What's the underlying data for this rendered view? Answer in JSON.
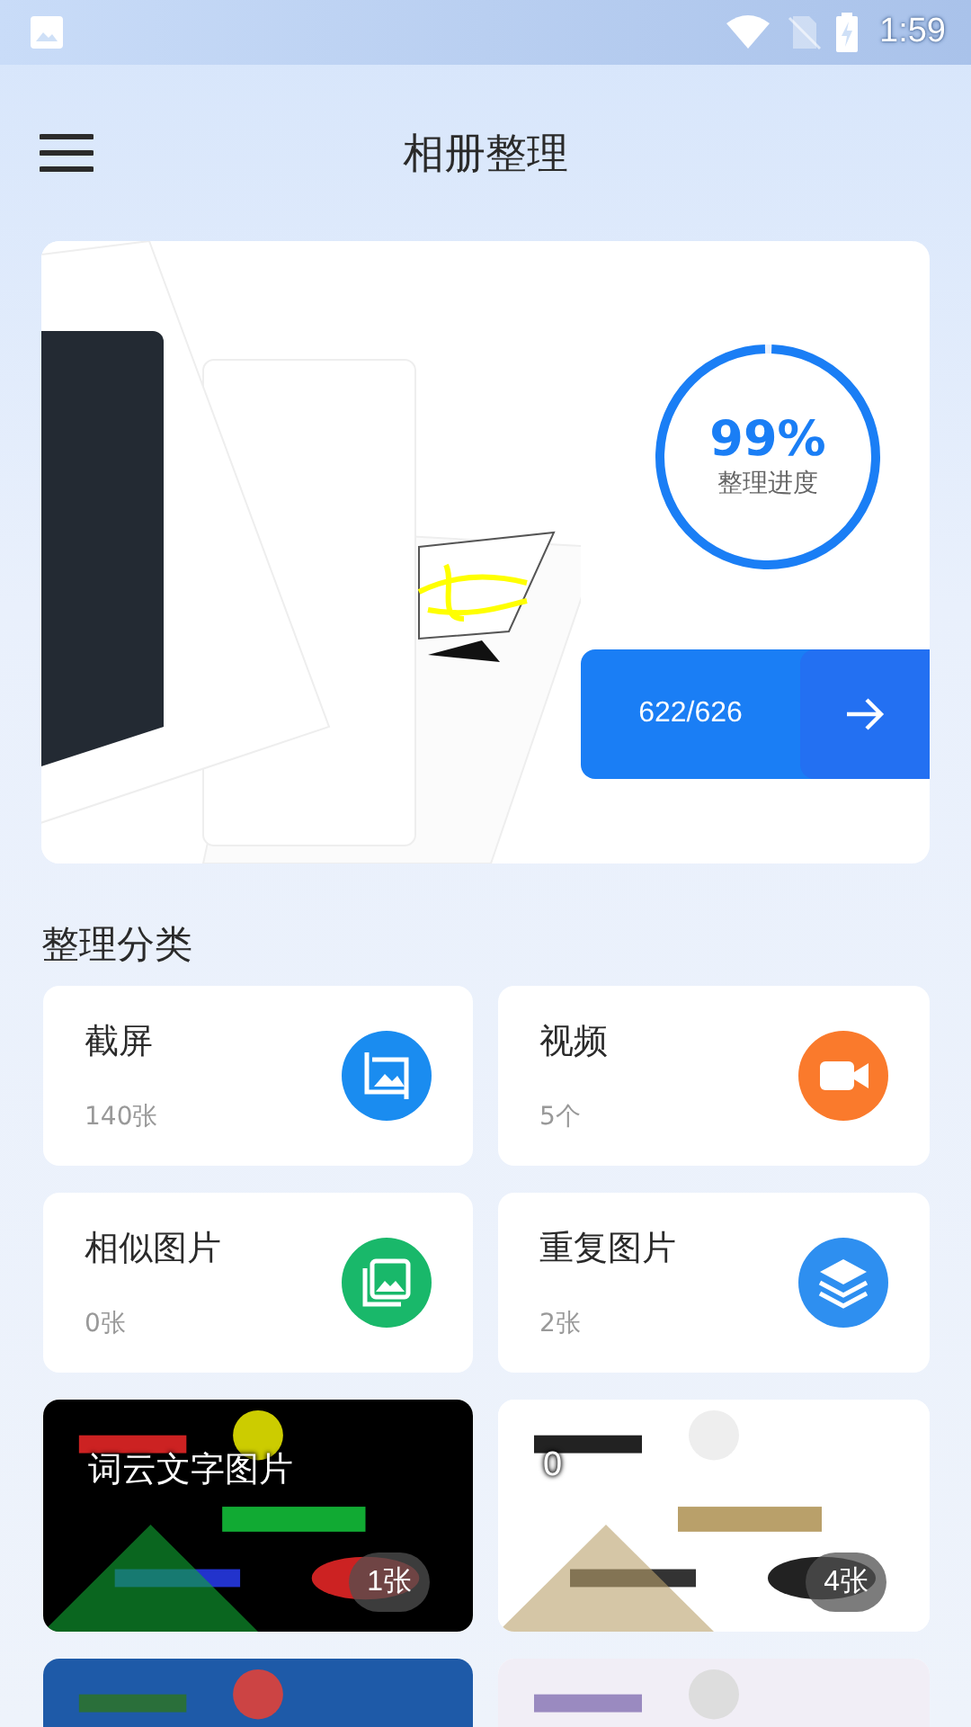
{
  "status_bar": {
    "time": "1:59"
  },
  "header": {
    "title": "相册整理"
  },
  "progress": {
    "percent": "99%",
    "label": "整理进度",
    "level": 0.99,
    "count": "622/626"
  },
  "section": {
    "title": "整理分类"
  },
  "categories": [
    {
      "name": "截屏",
      "count": "140张",
      "kind": "screenshot",
      "color": "#1a8cf0"
    },
    {
      "name": "视频",
      "count": "5个",
      "kind": "video",
      "color": "#fa7a2c"
    },
    {
      "name": "相似图片",
      "count": "0张",
      "kind": "similar",
      "color": "#19b86a"
    },
    {
      "name": "重复图片",
      "count": "2张",
      "kind": "duplicate",
      "color": "#2e8ff0"
    }
  ],
  "albums": [
    {
      "title": "词云文字图片",
      "count": "1张",
      "kind": "picture"
    },
    {
      "title": "0",
      "count": "4张",
      "kind": "picture"
    },
    {
      "kind": "picture"
    },
    {
      "kind": "picture"
    }
  ]
}
